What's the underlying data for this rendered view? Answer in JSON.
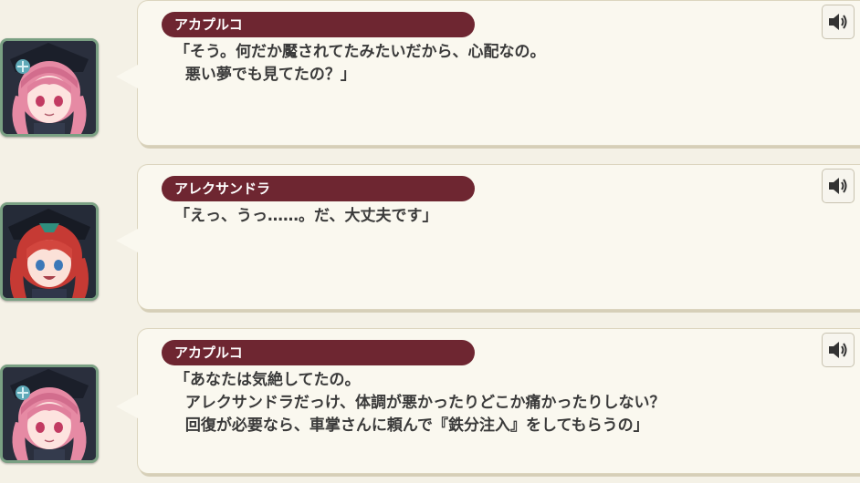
{
  "dialogue": [
    {
      "speaker": "アカプルコ",
      "avatar_icon": "acapulco-portrait",
      "line1": "「そう。何だか魘されてたみたいだから、心配なの。",
      "line2": "  悪い夢でも見てたの？」",
      "line3": ""
    },
    {
      "speaker": "アレクサンドラ",
      "avatar_icon": "alexandra-portrait",
      "line1": "「えっ、うっ……。だ、大丈夫です」",
      "line2": "",
      "line3": ""
    },
    {
      "speaker": "アカプルコ",
      "avatar_icon": "acapulco-portrait",
      "line1": "「あなたは気絶してたの。",
      "line2": "  アレクサンドラだっけ、体調が悪かったりどこか痛かったりしない？",
      "line3": "  回復が必要なら、車掌さんに頼んで『鉄分注入』をしてもらうの」"
    }
  ],
  "colors": {
    "name_bar": "#6e2631",
    "avatar_border": "#7aa083",
    "bubble": "#faf8ef",
    "background": "#f4f1e6"
  },
  "icons": {
    "sound": "speaker-icon"
  }
}
